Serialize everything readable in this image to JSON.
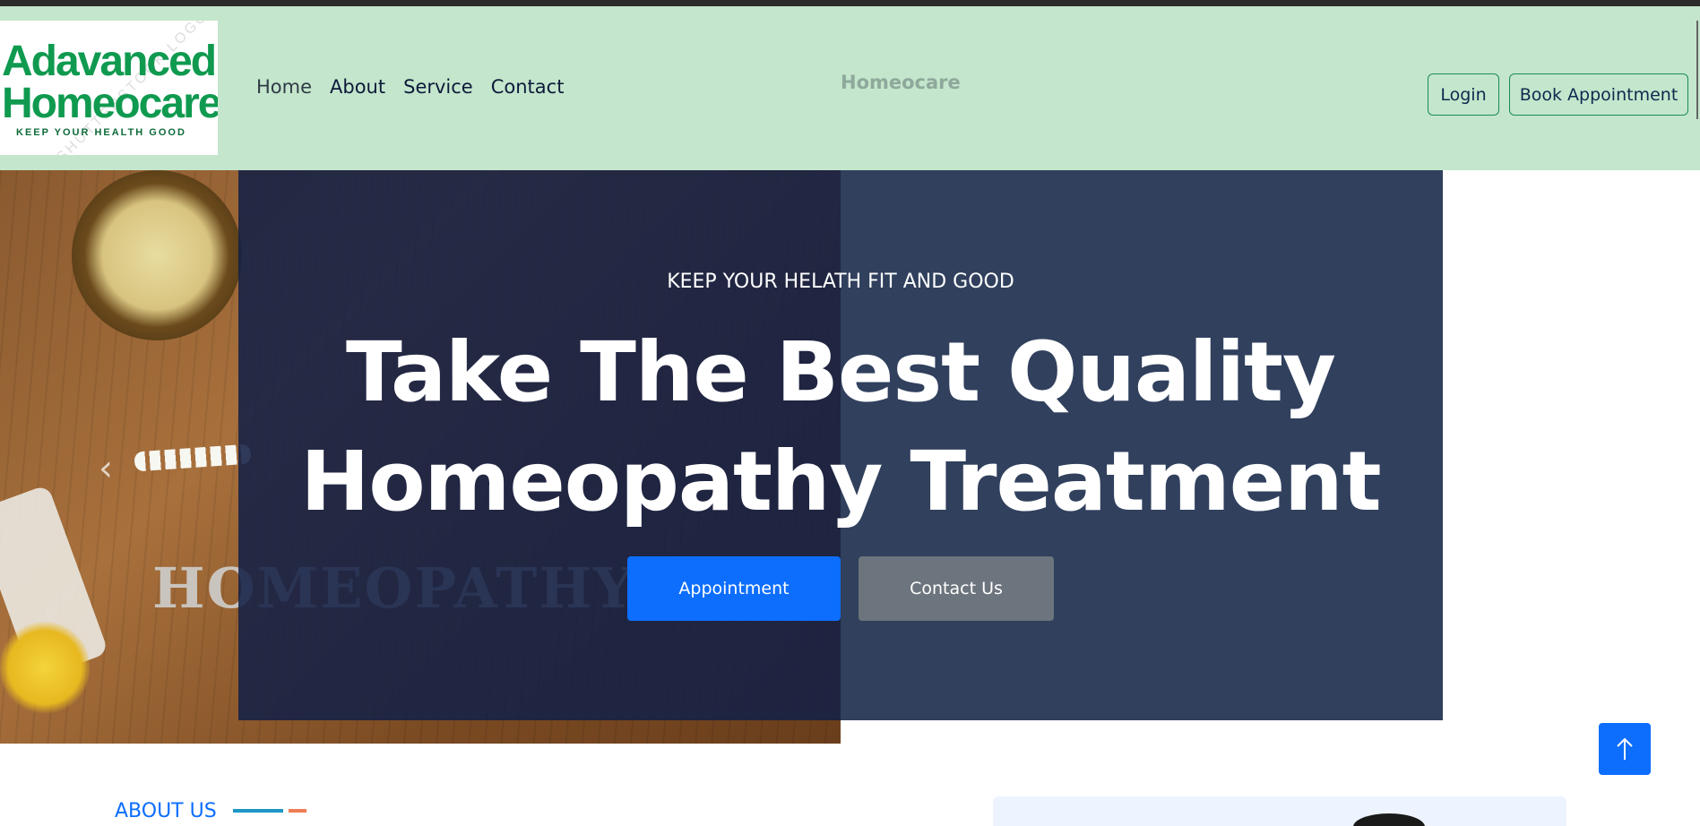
{
  "navbar": {
    "logo": {
      "line1": "Adavanced",
      "line2": "Homeocare",
      "tagline": "KEEP YOUR HEALTH GOOD",
      "watermark": "©SHUTTERSTOCK LOGO"
    },
    "links": [
      "Home",
      "About",
      "Service",
      "Contact"
    ],
    "brand": "Homeocare",
    "login_label": "Login",
    "book_label": "Book Appointment",
    "bg_color": "#c4e6cc"
  },
  "hero": {
    "kicker": "KEEP YOUR HELATH FIT AND GOOD",
    "title": "Take The Best Quality Homeopathy Treatment",
    "image_word": "HOMEOPATHY",
    "appointment_label": "Appointment",
    "contact_label": "Contact Us",
    "overlay_color": "#30405d",
    "primary_color": "#0d6efd",
    "secondary_color": "#6c757d"
  },
  "about": {
    "heading": "ABOUT US"
  },
  "icons": {
    "prev": "chevron-left-icon",
    "back_to_top": "arrow-up-icon"
  }
}
